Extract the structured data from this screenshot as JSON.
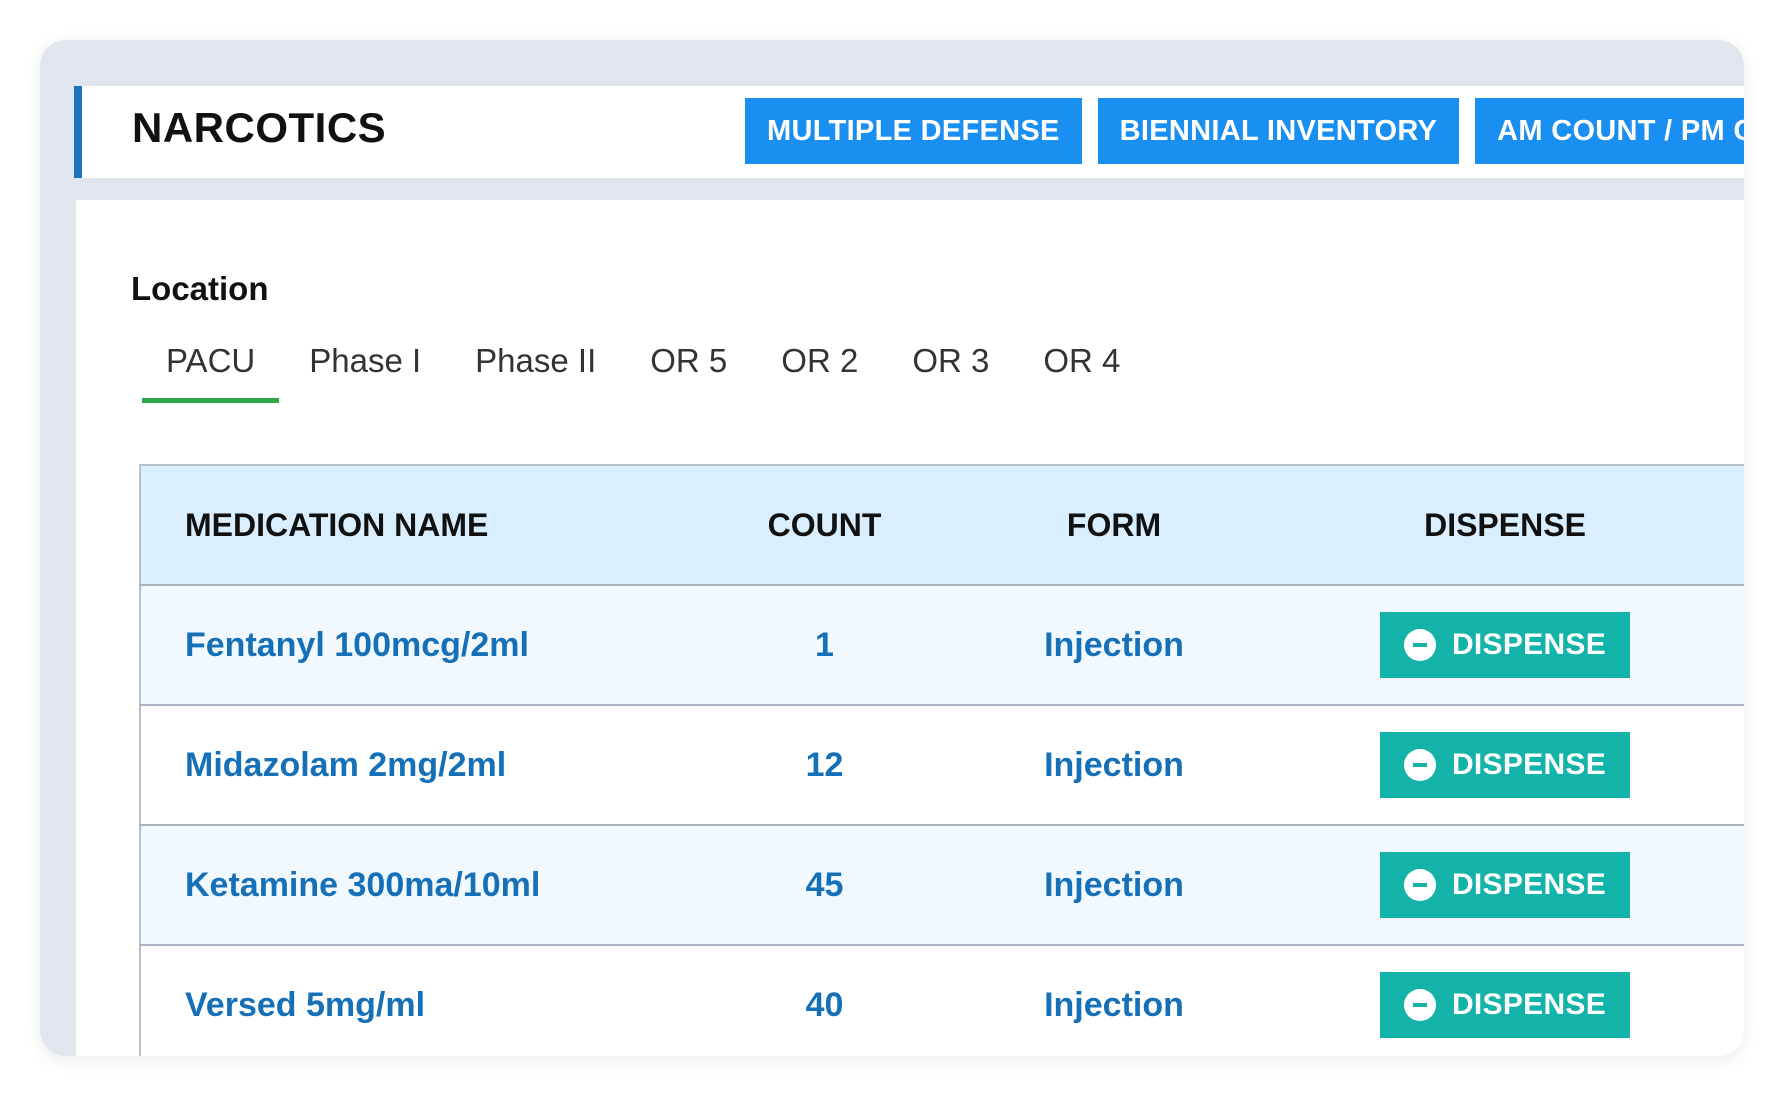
{
  "header": {
    "title": "NARCOTICS",
    "buttons": [
      "MULTIPLE DEFENSE",
      "BIENNIAL INVENTORY",
      "AM COUNT / PM COUNT"
    ]
  },
  "location": {
    "label": "Location",
    "tabs": [
      "PACU",
      "Phase I",
      "Phase II",
      "OR 5",
      "OR 2",
      "OR 3",
      "OR 4"
    ],
    "active_tab": "PACU"
  },
  "table": {
    "columns": [
      "MEDICATION NAME",
      "COUNT",
      "FORM",
      "DISPENSE"
    ],
    "rows": [
      {
        "name": "Fentanyl 100mcg/2ml",
        "count": "1",
        "form": "Injection",
        "action": "DISPENSE"
      },
      {
        "name": "Midazolam 2mg/2ml",
        "count": "12",
        "form": "Injection",
        "action": "DISPENSE"
      },
      {
        "name": "Ketamine 300ma/10ml",
        "count": "45",
        "form": "Injection",
        "action": "DISPENSE"
      },
      {
        "name": "Versed 5mg/ml",
        "count": "40",
        "form": "Injection",
        "action": "DISPENSE"
      }
    ]
  },
  "colors": {
    "header_accent": "#1b76c2",
    "nav_button": "#1a8ff2",
    "active_tab_underline": "#2ea84a",
    "table_header_bg": "#d9efff",
    "row_text": "#1570b8",
    "dispense_button": "#13b3aa"
  },
  "icons": {
    "dispense": "minus-circle-icon"
  }
}
